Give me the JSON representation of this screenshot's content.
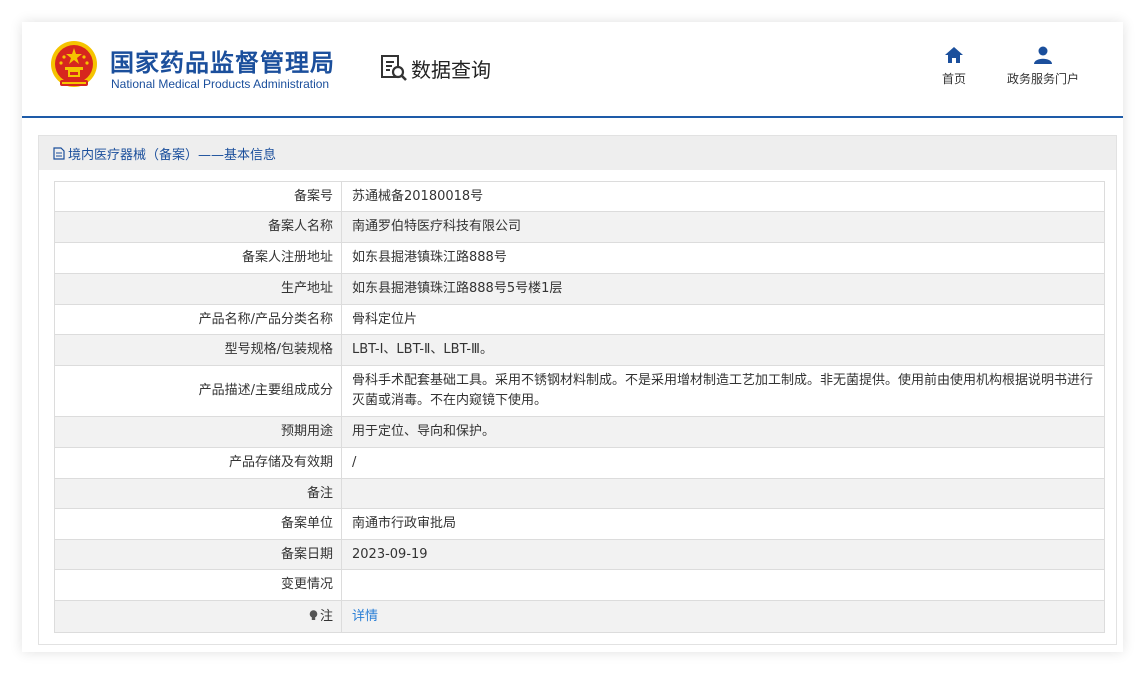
{
  "header": {
    "org_name_cn": "国家药品监督管理局",
    "org_name_en": "National Medical Products Administration",
    "query_label": "数据查询",
    "nav": [
      {
        "label": "首页",
        "icon": "home-icon"
      },
      {
        "label": "政务服务门户",
        "icon": "user-icon"
      }
    ]
  },
  "panel": {
    "title": "境内医疗器械（备案）——基本信息"
  },
  "rows": [
    {
      "key": "备案号",
      "value": "苏通械备20180018号"
    },
    {
      "key": "备案人名称",
      "value": "南通罗伯特医疗科技有限公司"
    },
    {
      "key": "备案人注册地址",
      "value": "如东县掘港镇珠江路888号"
    },
    {
      "key": "生产地址",
      "value": "如东县掘港镇珠江路888号5号楼1层"
    },
    {
      "key": "产品名称/产品分类名称",
      "value": "骨科定位片"
    },
    {
      "key": "型号规格/包装规格",
      "value": "LBT-Ⅰ、LBT-Ⅱ、LBT-Ⅲ。"
    },
    {
      "key": "产品描述/主要组成成分",
      "value": "骨科手术配套基础工具。采用不锈钢材料制成。不是采用增材制造工艺加工制成。非无菌提供。使用前由使用机构根据说明书进行灭菌或消毒。不在内窥镜下使用。"
    },
    {
      "key": "预期用途",
      "value": "用于定位、导向和保护。"
    },
    {
      "key": "产品存储及有效期",
      "value": "/"
    },
    {
      "key": "备注",
      "value": ""
    },
    {
      "key": "备案单位",
      "value": "南通市行政审批局"
    },
    {
      "key": "备案日期",
      "value": "2023-09-19"
    },
    {
      "key": "变更情况",
      "value": ""
    },
    {
      "key": "注",
      "value": "详情"
    }
  ],
  "colors": {
    "brand_blue": "#1b4f9c",
    "link_blue": "#2a7fd6",
    "row_alt": "#f2f2f2",
    "emblem_red": "#d7261e",
    "emblem_gold": "#f5c400"
  }
}
